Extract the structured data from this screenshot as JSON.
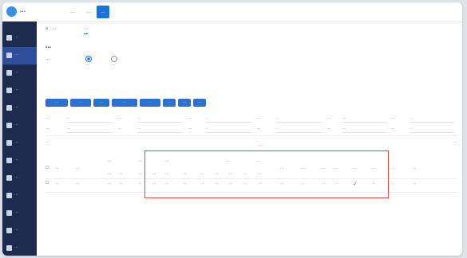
{
  "app": {
    "brand": "…"
  },
  "topnav": [
    "…",
    "…",
    "…"
  ],
  "sidebar": {
    "items": [
      "…",
      "…",
      "…",
      "…",
      "…",
      "…",
      "…",
      "…",
      "…",
      "…",
      "…",
      "…",
      "…"
    ]
  },
  "tabs": [
    "…",
    "…"
  ],
  "page_title": "…",
  "radios": {
    "option_a": "…",
    "option_b": "…"
  },
  "buttons": [
    "…",
    "…",
    "…",
    "…",
    "…",
    "…",
    "…",
    "…"
  ],
  "filters": {
    "row1": {
      "l1": "…",
      "v1": "…",
      "l2": "…",
      "v2": "…",
      "l3": "…",
      "v3": "…",
      "l4": "…",
      "v4": "…",
      "l5": "…",
      "v5": "…",
      "l6": "…",
      "v6": "…"
    },
    "row2": {
      "l1": "…",
      "v1": "…",
      "l2": "…",
      "v2": "…",
      "l3": "…",
      "v3": "…",
      "l4": "…",
      "v4": "…",
      "l5": "…",
      "v5": "…",
      "l6": "…",
      "v6": "…"
    }
  },
  "list": {
    "label": "…",
    "pager": "…"
  },
  "annotation_label": "…",
  "table": {
    "group_headers": [
      "…",
      "…",
      "…",
      "…",
      "…"
    ],
    "headers": [
      "…",
      "…",
      "…",
      "…",
      "…",
      "…",
      "…",
      "…",
      "…",
      "…",
      "…",
      "…",
      "…",
      "…",
      "…",
      "…",
      "…",
      "…",
      "…",
      "…",
      "…"
    ],
    "row": [
      "…",
      "…",
      "…",
      "…",
      "…",
      "…",
      "…",
      "…",
      "…",
      "…",
      "…",
      "…",
      "…",
      "…",
      "…",
      "…",
      "…",
      "…",
      "…",
      "…",
      "…"
    ]
  }
}
